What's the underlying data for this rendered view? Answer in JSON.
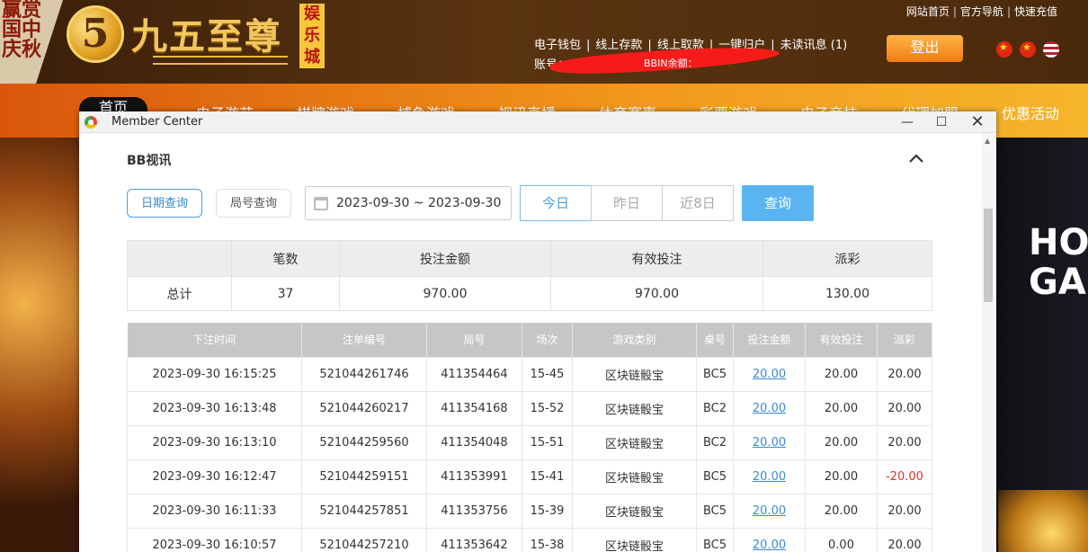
{
  "site": {
    "corner_text": "赢赏国中庆秋",
    "logo_digit": "5",
    "logo_name": "九五至尊",
    "logo_sub": "娱乐城",
    "top_links": [
      "网站首页",
      "官方导航",
      "快速充值"
    ],
    "account_links": [
      "电子钱包",
      "线上存款",
      "线上取款",
      "一键归户",
      "未读讯息 (1)"
    ],
    "account_label": "账号：",
    "account_partial": "BBIN余额：",
    "logout_label": "登出",
    "nav": [
      "首页",
      "电子游艺",
      "棋牌游戏",
      "捕鱼游戏",
      "视讯直播",
      "体育赛事",
      "彩票游戏",
      "电子竞技",
      "代理加盟",
      "优惠活动"
    ],
    "hero_text": "HOT GAM",
    "colors": {
      "accent_blue": "#4a9fe0",
      "nav_orange": "#f29a1c",
      "negative": "#e03030"
    }
  },
  "window": {
    "title": "Member Center"
  },
  "panel": {
    "section_title": "BB视讯",
    "btn_date_query": "日期查询",
    "btn_round_query": "局号查询",
    "date_range": "2023-09-30 ~ 2023-09-30",
    "seg_today": "今日",
    "seg_yesterday": "昨日",
    "seg_8days": "近8日",
    "btn_query": "查询"
  },
  "summary": {
    "headers": [
      "",
      "笔数",
      "投注金额",
      "有效投注",
      "派彩"
    ],
    "row": [
      "总计",
      "37",
      "970.00",
      "970.00",
      "130.00"
    ]
  },
  "details": {
    "headers": [
      "下注时间",
      "注单编号",
      "局号",
      "场次",
      "游戏类别",
      "桌号",
      "投注金额",
      "有效投注",
      "派彩"
    ],
    "rows": [
      [
        "2023-09-30 16:15:25",
        "521044261746",
        "411354464",
        "15-45",
        "区块链骰宝",
        "BC5",
        "20.00",
        "20.00",
        "20.00"
      ],
      [
        "2023-09-30 16:13:48",
        "521044260217",
        "411354168",
        "15-52",
        "区块链骰宝",
        "BC2",
        "20.00",
        "20.00",
        "20.00"
      ],
      [
        "2023-09-30 16:13:10",
        "521044259560",
        "411354048",
        "15-51",
        "区块链骰宝",
        "BC2",
        "20.00",
        "20.00",
        "20.00"
      ],
      [
        "2023-09-30 16:12:47",
        "521044259151",
        "411353991",
        "15-41",
        "区块链骰宝",
        "BC5",
        "20.00",
        "20.00",
        "-20.00"
      ],
      [
        "2023-09-30 16:11:33",
        "521044257851",
        "411353756",
        "15-39",
        "区块链骰宝",
        "BC5",
        "20.00",
        "20.00",
        "20.00"
      ],
      [
        "2023-09-30 16:10:57",
        "521044257210",
        "411353642",
        "15-38",
        "区块链骰宝",
        "BC5",
        "20.00",
        "0.00",
        "20.00"
      ]
    ]
  }
}
